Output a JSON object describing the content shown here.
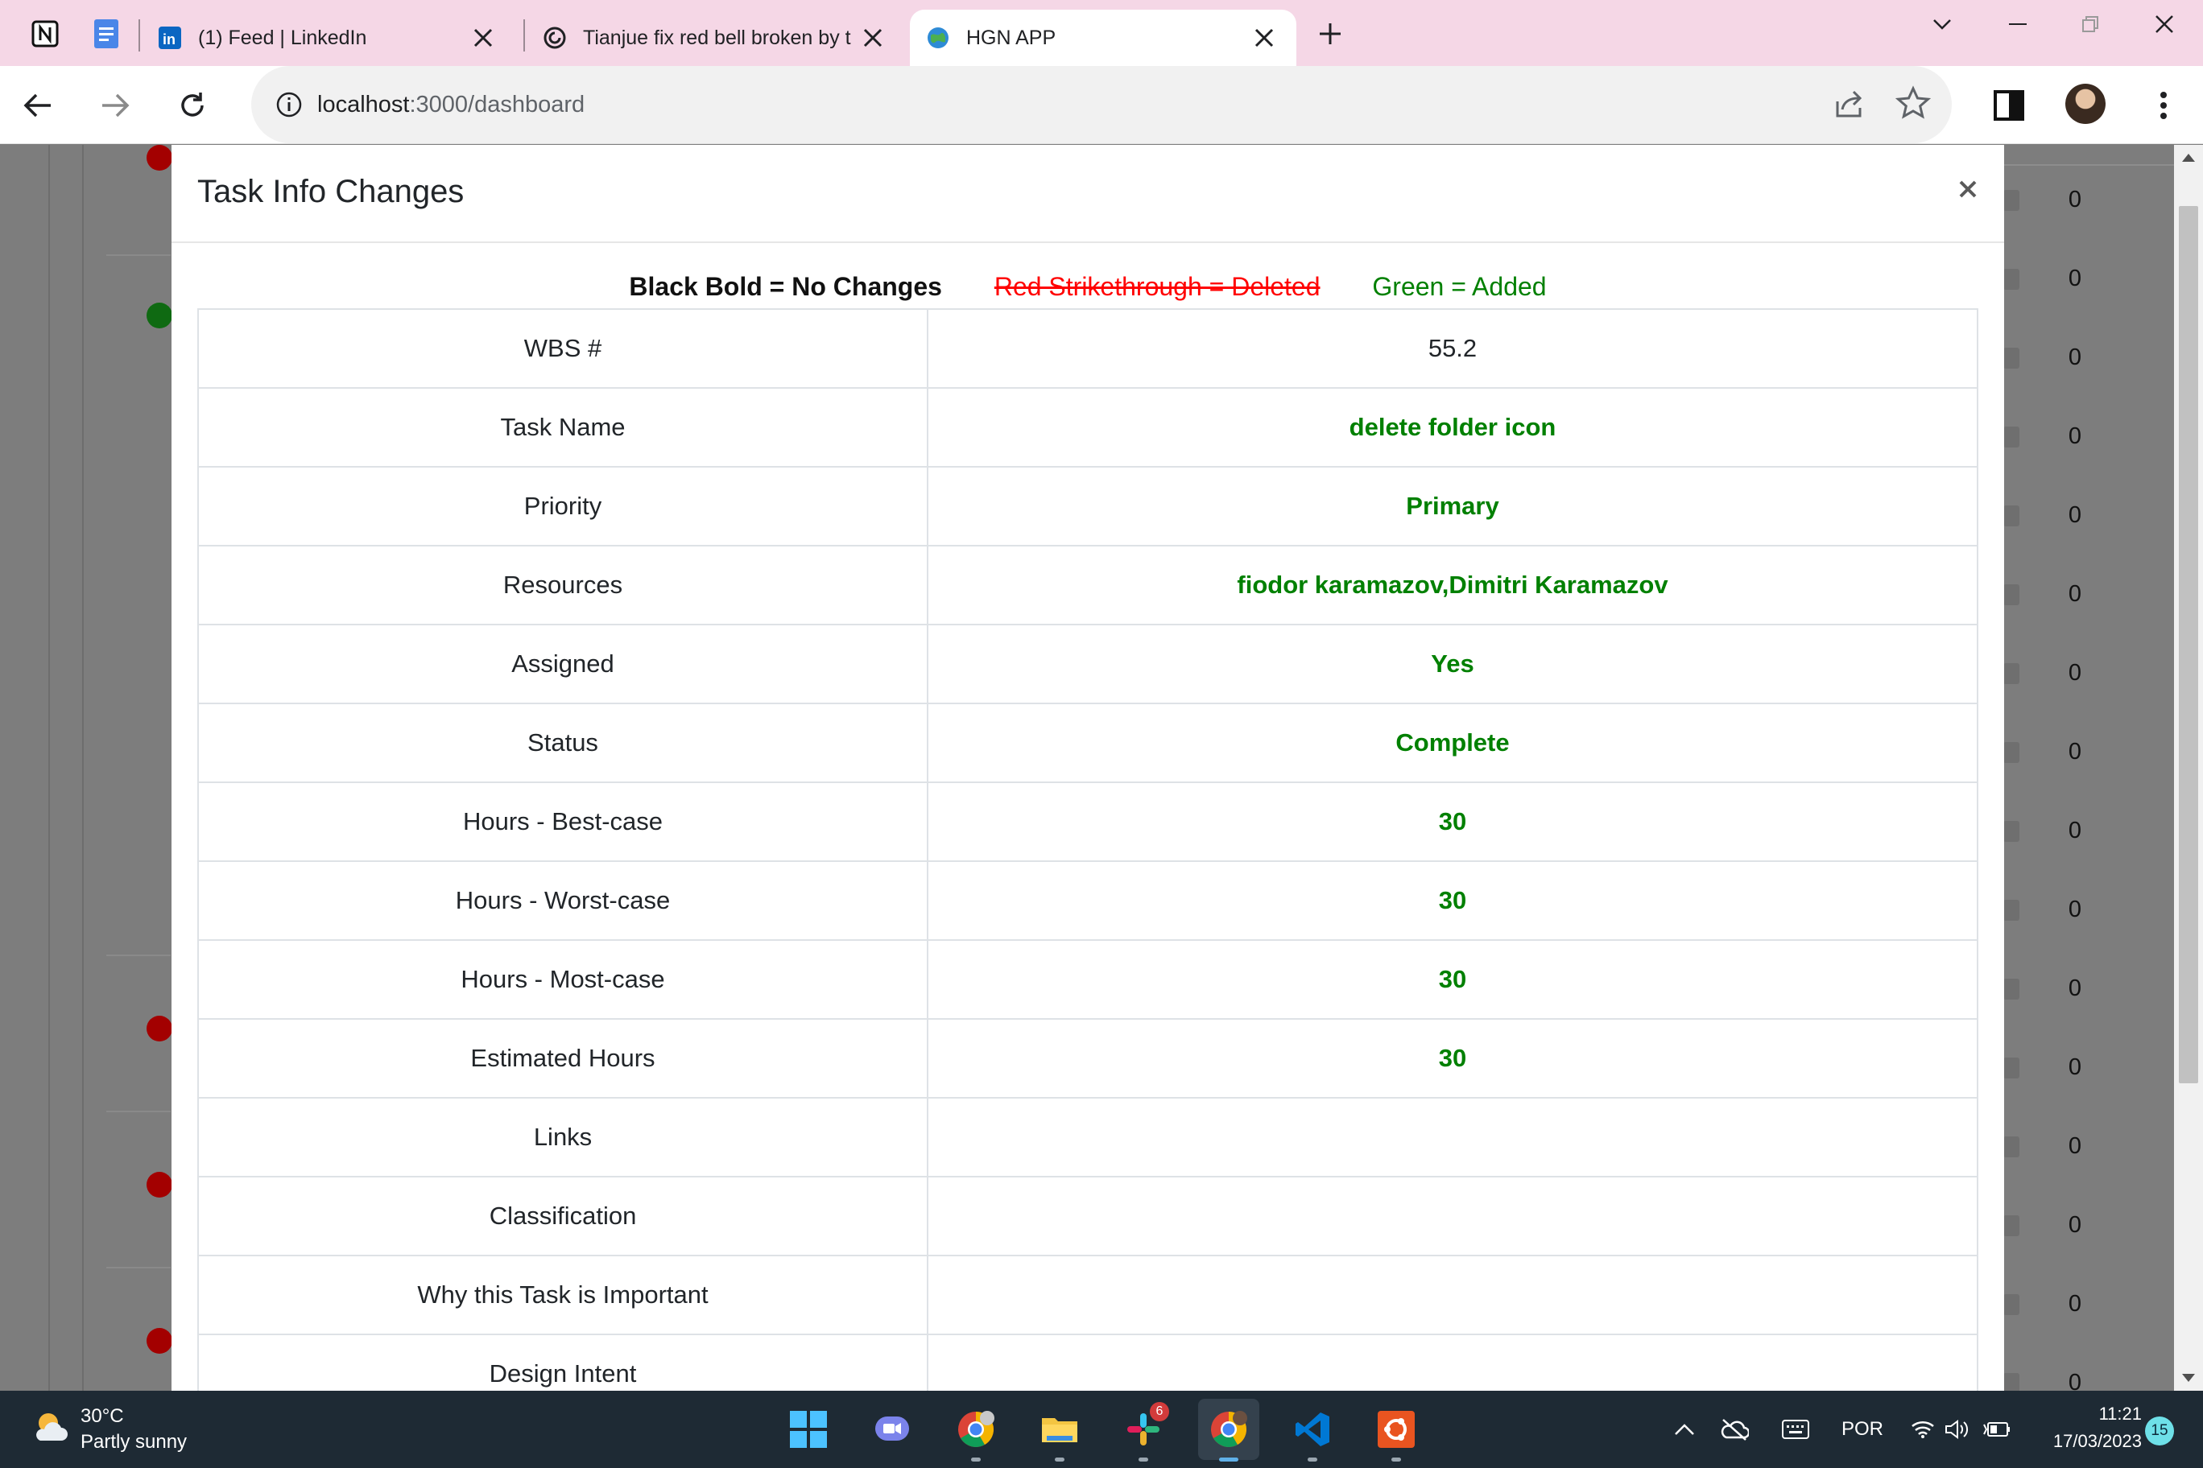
{
  "browser": {
    "tabs": [
      {
        "label": "(1) Feed | LinkedIn",
        "icon": "linkedin-icon"
      },
      {
        "label": "Tianjue fix red bell broken by t",
        "icon": "github-icon"
      },
      {
        "label": "HGN APP",
        "icon": "hgn-app-icon",
        "active": true
      }
    ],
    "pinned_icons": [
      "notion-icon",
      "google-docs-icon"
    ],
    "url_host": "localhost",
    "url_path": ":3000/dashboard"
  },
  "background_page": {
    "row_values": [
      "0",
      "0",
      "0",
      "0",
      "0",
      "0",
      "0",
      "0",
      "0",
      "0",
      "0",
      "0",
      "0",
      "0",
      "0",
      "0"
    ],
    "status_dots": [
      {
        "color": "#a30000"
      },
      {
        "color": "#0f6a12"
      },
      {
        "color": "#a30000"
      },
      {
        "color": "#a30000"
      },
      {
        "color": "#a30000"
      }
    ]
  },
  "modal": {
    "title": "Task Info Changes",
    "close_symbol": "×",
    "legend": {
      "no_changes": "Black Bold = No Changes",
      "deleted": "Red Strikethrough = Deleted",
      "added": "Green = Added"
    },
    "rows": [
      {
        "label": "WBS #",
        "value": "55.2",
        "state": "plain"
      },
      {
        "label": "Task Name",
        "value": "delete folder icon",
        "state": "added"
      },
      {
        "label": "Priority",
        "value": "Primary",
        "state": "added"
      },
      {
        "label": "Resources",
        "value": "fiodor karamazov,Dimitri Karamazov",
        "state": "added"
      },
      {
        "label": "Assigned",
        "value": "Yes",
        "state": "added"
      },
      {
        "label": "Status",
        "value": "Complete",
        "state": "added"
      },
      {
        "label": "Hours - Best-case",
        "value": "30",
        "state": "added"
      },
      {
        "label": "Hours - Worst-case",
        "value": "30",
        "state": "added"
      },
      {
        "label": "Hours - Most-case",
        "value": "30",
        "state": "added"
      },
      {
        "label": "Estimated Hours",
        "value": "30",
        "state": "added"
      },
      {
        "label": "Links",
        "value": "",
        "state": "plain"
      },
      {
        "label": "Classification",
        "value": "",
        "state": "plain"
      },
      {
        "label": "Why this Task is Important",
        "value": "",
        "state": "plain"
      },
      {
        "label": "Design Intent",
        "value": "",
        "state": "plain"
      }
    ],
    "colors": {
      "added": "#008000",
      "deleted": "#ff0000"
    }
  },
  "taskbar": {
    "weather": {
      "temp": "30°C",
      "desc": "Partly sunny"
    },
    "apps": [
      {
        "name": "start-button"
      },
      {
        "name": "teams-app"
      },
      {
        "name": "chrome-app-profile"
      },
      {
        "name": "file-explorer-app"
      },
      {
        "name": "slack-app",
        "badge": "6"
      },
      {
        "name": "chrome-app-active"
      },
      {
        "name": "vscode-app"
      },
      {
        "name": "ubuntu-app"
      }
    ],
    "language": "POR",
    "time": "11:21",
    "date": "17/03/2023",
    "notifications": "15"
  }
}
